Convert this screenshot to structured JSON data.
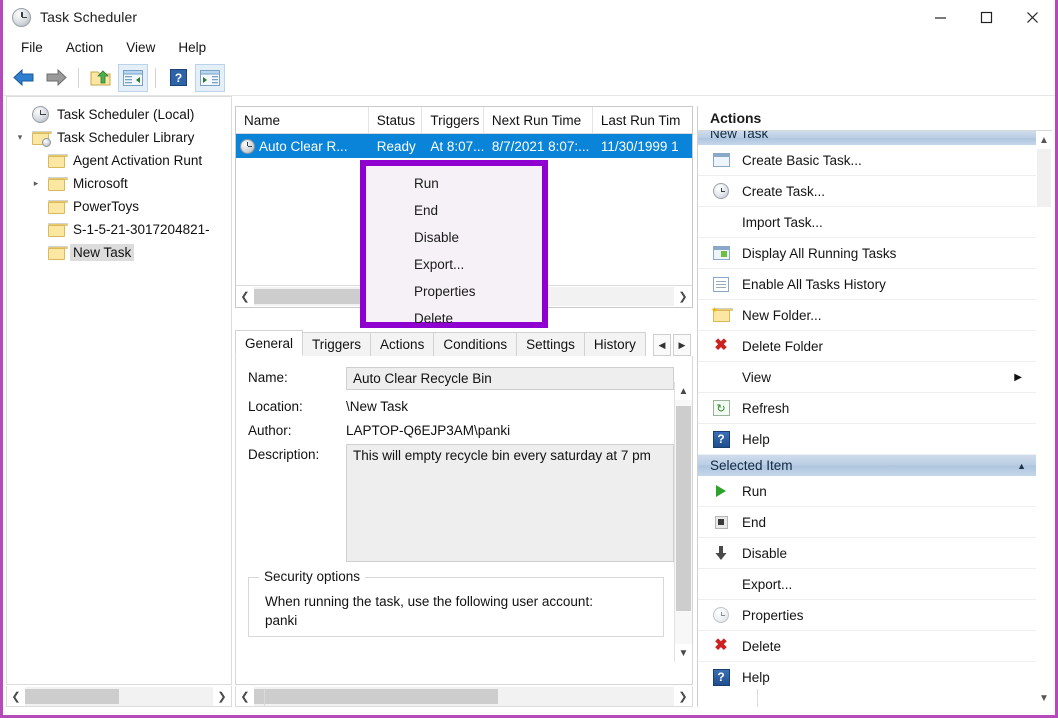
{
  "window": {
    "title": "Task Scheduler",
    "icon": "clock-icon",
    "minimize_label": "Minimize",
    "maximize_label": "Maximize",
    "close_label": "Close",
    "border_color": "#b44bb8"
  },
  "menubar": {
    "items": [
      "File",
      "Action",
      "View",
      "Help"
    ]
  },
  "toolbar": {
    "buttons": [
      {
        "name": "back-arrow-icon",
        "label": "Back"
      },
      {
        "name": "forward-arrow-icon",
        "label": "Forward"
      },
      {
        "name": "up-folder-icon",
        "label": "Up One Level"
      },
      {
        "name": "show-hide-console-tree-icon",
        "label": "Show/Hide Console Tree"
      },
      {
        "name": "help-icon",
        "label": "Help"
      },
      {
        "name": "show-hide-action-pane-icon",
        "label": "Show/Hide Action Pane"
      }
    ]
  },
  "tree": {
    "root": {
      "label": "Task Scheduler (Local)",
      "icon": "clock-icon"
    },
    "items": [
      {
        "label": "Task Scheduler Library",
        "indent": 1,
        "twist": "expanded",
        "icon": "folder-clock-icon",
        "selected": false
      },
      {
        "label": "Agent Activation Runt",
        "indent": 2,
        "twist": "",
        "icon": "folder-icon",
        "selected": false
      },
      {
        "label": "Microsoft",
        "indent": 2,
        "twist": "collapsed",
        "icon": "folder-icon",
        "selected": false
      },
      {
        "label": "PowerToys",
        "indent": 2,
        "twist": "",
        "icon": "folder-icon",
        "selected": false
      },
      {
        "label": "S-1-5-21-3017204821-",
        "indent": 2,
        "twist": "",
        "icon": "folder-icon",
        "selected": false
      },
      {
        "label": "New Task",
        "indent": 2,
        "twist": "",
        "icon": "folder-icon",
        "selected": true
      }
    ]
  },
  "task_list": {
    "columns": [
      "Name",
      "Status",
      "Triggers",
      "Next Run Time",
      "Last Run Tim"
    ],
    "rows": [
      {
        "name": "Auto Clear R...",
        "status": "Ready",
        "triggers": "At 8:07...",
        "next_run_time": "8/7/2021 8:07:...",
        "last_run_time": "11/30/1999 1",
        "selected": true,
        "selected_color": "#0a84d8"
      }
    ]
  },
  "context_menu": {
    "highlight_color": "#8f00d0",
    "items": [
      "Run",
      "End",
      "Disable",
      "Export...",
      "Properties",
      "Delete"
    ]
  },
  "detail": {
    "tabs": [
      {
        "label": "General",
        "active": true
      },
      {
        "label": "Triggers",
        "active": false
      },
      {
        "label": "Actions",
        "active": false
      },
      {
        "label": "Conditions",
        "active": false
      },
      {
        "label": "Settings",
        "active": false
      },
      {
        "label": "History",
        "active": false
      }
    ],
    "tab_nav": {
      "prev": "◀",
      "next": "▶"
    },
    "fields": [
      {
        "label": "Name:",
        "value": "Auto Clear Recycle Bin",
        "type": "textbox"
      },
      {
        "label": "Location:",
        "value": "\\New Task",
        "type": "text"
      },
      {
        "label": "Author:",
        "value": "LAPTOP-Q6EJP3AM\\panki",
        "type": "text"
      },
      {
        "label": "Description:",
        "value": "This will empty recycle bin every saturday at 7 pm",
        "type": "textarea"
      }
    ],
    "security": {
      "title": "Security options",
      "line1": "When running the task, use the following user account:",
      "line2": "panki"
    }
  },
  "actions": {
    "title": "Actions",
    "groups": [
      {
        "header": "New Task",
        "header_clipped": true,
        "items": [
          {
            "label": "Create Basic Task...",
            "icon": "create-basic-task-icon"
          },
          {
            "label": "Create Task...",
            "icon": "create-task-icon"
          },
          {
            "label": "Import Task...",
            "icon": ""
          },
          {
            "label": "Display All Running Tasks",
            "icon": "running-tasks-icon"
          },
          {
            "label": "Enable All Tasks History",
            "icon": "history-icon"
          },
          {
            "label": "New Folder...",
            "icon": "new-folder-icon"
          },
          {
            "label": "Delete Folder",
            "icon": "delete-x-icon"
          },
          {
            "label": "View",
            "icon": "",
            "submenu": true
          },
          {
            "label": "Refresh",
            "icon": "refresh-icon"
          },
          {
            "label": "Help",
            "icon": "help-icon"
          }
        ]
      },
      {
        "header": "Selected Item",
        "header_clipped": false,
        "collapse_caret": "▲",
        "items": [
          {
            "label": "Run",
            "icon": "run-play-icon"
          },
          {
            "label": "End",
            "icon": "end-stop-icon"
          },
          {
            "label": "Disable",
            "icon": "disable-down-arrow-icon"
          },
          {
            "label": "Export...",
            "icon": ""
          },
          {
            "label": "Properties",
            "icon": "properties-clock-icon"
          },
          {
            "label": "Delete",
            "icon": "delete-x-icon"
          },
          {
            "label": "Help",
            "icon": "help-icon"
          }
        ]
      }
    ]
  }
}
